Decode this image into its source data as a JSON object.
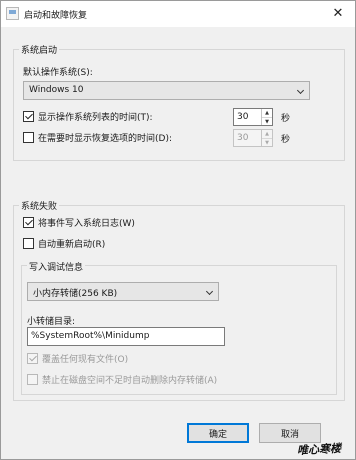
{
  "window": {
    "title": "启动和故障恢复",
    "close_glyph": "✕"
  },
  "system_startup": {
    "group_label": "系统启动",
    "default_os_label": "默认操作系统(S):",
    "default_os_value": "Windows 10",
    "show_os_list": {
      "label": "显示操作系统列表的时间(T):",
      "checked": true,
      "value": "30",
      "unit": "秒"
    },
    "show_recovery": {
      "label": "在需要时显示恢复选项的时间(D):",
      "checked": false,
      "value": "30",
      "unit": "秒"
    }
  },
  "system_failure": {
    "group_label": "系统失败",
    "write_event": {
      "label": "将事件写入系统日志(W)",
      "checked": true
    },
    "auto_restart": {
      "label": "自动重新启动(R)",
      "checked": false
    },
    "debug_info": {
      "group_label": "写入调试信息",
      "dump_type_value": "小内存转储(256 KB)",
      "dir_label": "小转储目录:",
      "dir_value": "%SystemRoot%\\Minidump",
      "overwrite": {
        "label": "覆盖任何现有文件(O)",
        "checked": true,
        "enabled": false
      },
      "disable_auto_delete": {
        "label": "禁止在磁盘空间不足时自动删除内存转储(A)",
        "checked": false,
        "enabled": false
      }
    }
  },
  "buttons": {
    "ok": "确定",
    "cancel": "取消"
  },
  "spin_arrows": {
    "up": "▲",
    "down": "▼"
  },
  "watermark": "唯心寒楼"
}
